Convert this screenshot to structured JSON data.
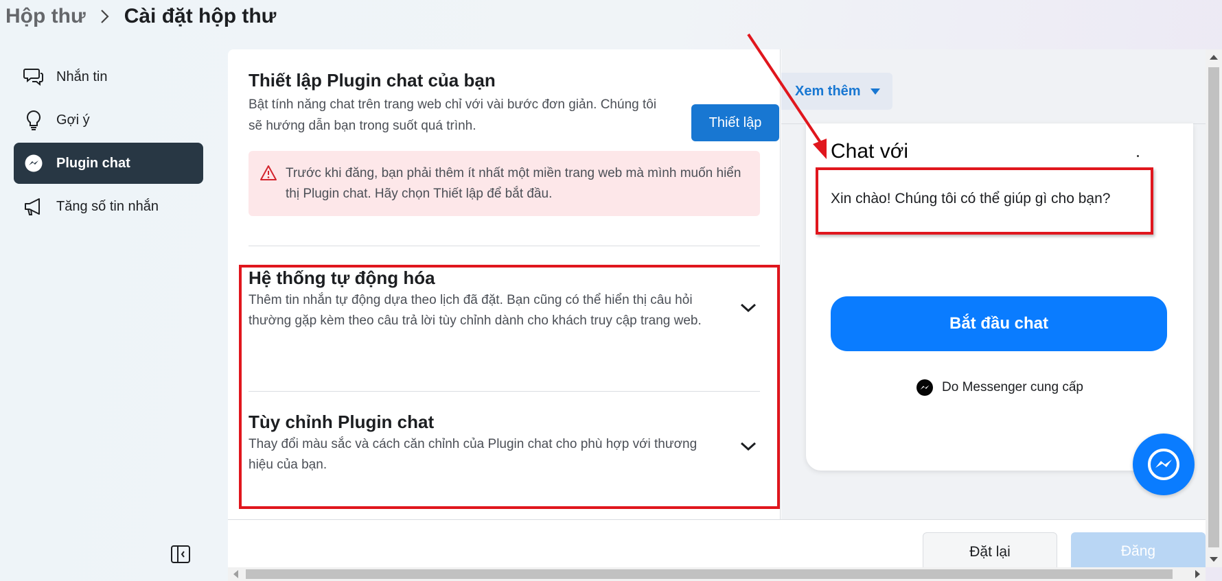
{
  "breadcrumb": {
    "root": "Hộp thư",
    "current": "Cài đặt hộp thư"
  },
  "sidebar": {
    "items": [
      {
        "label": "Nhắn tin",
        "icon": "chat-bubbles-icon"
      },
      {
        "label": "Gợi ý",
        "icon": "lightbulb-icon"
      },
      {
        "label": "Plugin chat",
        "icon": "messenger-icon",
        "active": true
      },
      {
        "label": "Tăng số tin nhắn",
        "icon": "megaphone-icon"
      }
    ]
  },
  "setup": {
    "title": "Thiết lập Plugin chat của bạn",
    "desc": "Bật tính năng chat trên trang web chỉ với vài bước đơn giản. Chúng tôi sẽ hướng dẫn bạn trong suốt quá trình.",
    "button": "Thiết lập"
  },
  "warning": {
    "text": "Trước khi đăng, bạn phải thêm ít nhất một miền trang web mà mình muốn hiển thị Plugin chat. Hãy chọn Thiết lập để bắt đầu."
  },
  "sections": [
    {
      "title": "Hệ thống tự động hóa",
      "desc": "Thêm tin nhắn tự động dựa theo lịch đã đặt. Bạn cũng có thể hiển thị câu hỏi thường gặp kèm theo câu trả lời tùy chỉnh dành cho khách truy cập trang web."
    },
    {
      "title": "Tùy chỉnh Plugin chat",
      "desc": "Thay đổi màu sắc và cách căn chỉnh của Plugin chat cho phù hợp với thương hiệu của bạn."
    }
  ],
  "preview": {
    "see_more": "Xem thêm",
    "chat_title": "Chat với",
    "greeting": "Xin chào! Chúng tôi có thể giúp gì cho bạn?",
    "start_button": "Bắt đầu chat",
    "powered_by": "Do Messenger cung cấp"
  },
  "footer": {
    "reset": "Đặt lại",
    "post": "Đăng"
  },
  "colors": {
    "primary": "#1877d2",
    "messenger_blue": "#0a7cff",
    "annotation_red": "#e0161d",
    "active_nav": "#283744",
    "warning_bg": "#fde7e9"
  }
}
